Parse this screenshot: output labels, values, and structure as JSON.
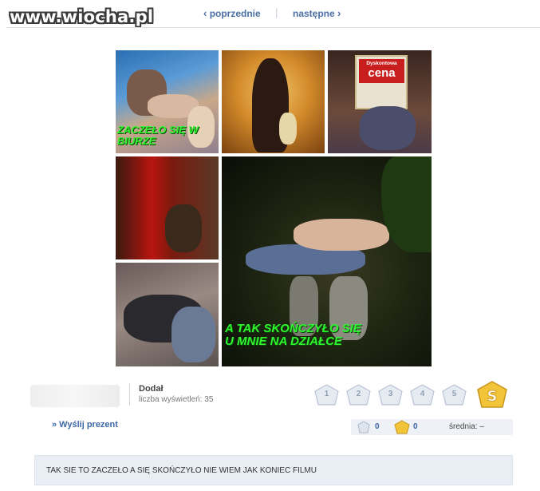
{
  "header": {
    "logo": "www.wiocha.pl",
    "prev_label": "poprzednie",
    "next_label": "następne",
    "separator": "|"
  },
  "collage": {
    "captions": {
      "top_left": "ZACZEŁO SIĘ W BIURZE",
      "main": "A TAK SKOŃCZYŁO SIĘ U MNIE NA DZIAŁCE"
    },
    "sign": {
      "line1": "Dyskontowa",
      "line2": "cena"
    },
    "caption_color": "#2ef52e"
  },
  "meta": {
    "added_label": "Dodał",
    "views_label": "liczba wyświetleń: 35"
  },
  "rating": {
    "stars": [
      "1",
      "2",
      "3",
      "4",
      "5"
    ],
    "super_icon": "super-badge-icon"
  },
  "actions": {
    "gift_label": "» Wyślij prezent"
  },
  "stats": {
    "star_count": "0",
    "super_count": "0",
    "average_label": "średnia: –"
  },
  "description": {
    "text": "TAK SIE TO ZACZEŁO A SIĘ SKOŃCZYŁO NIE WIEM JAK KONIEC FILMU"
  },
  "colors": {
    "link": "#3d68a8",
    "desc_bg": "#e9eef5"
  }
}
